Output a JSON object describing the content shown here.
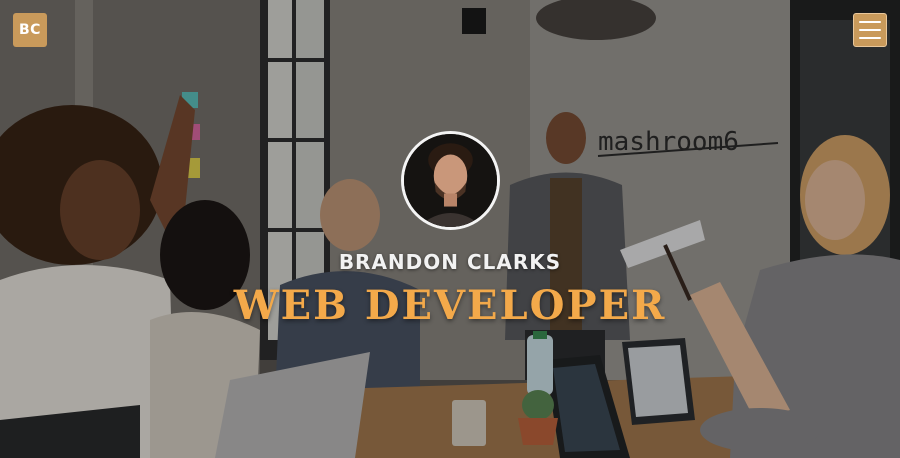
{
  "header": {
    "logo_text": "BC",
    "menu_icon": "hamburger-menu-icon",
    "accent_color": "#c99a5b"
  },
  "profile": {
    "name": "BRANDON CLARKS",
    "role": "WEB DEVELOPER",
    "role_color": "#f3a94a",
    "avatar_alt": "profile photo"
  },
  "background": {
    "wall_sign_text": "mashroom6"
  }
}
